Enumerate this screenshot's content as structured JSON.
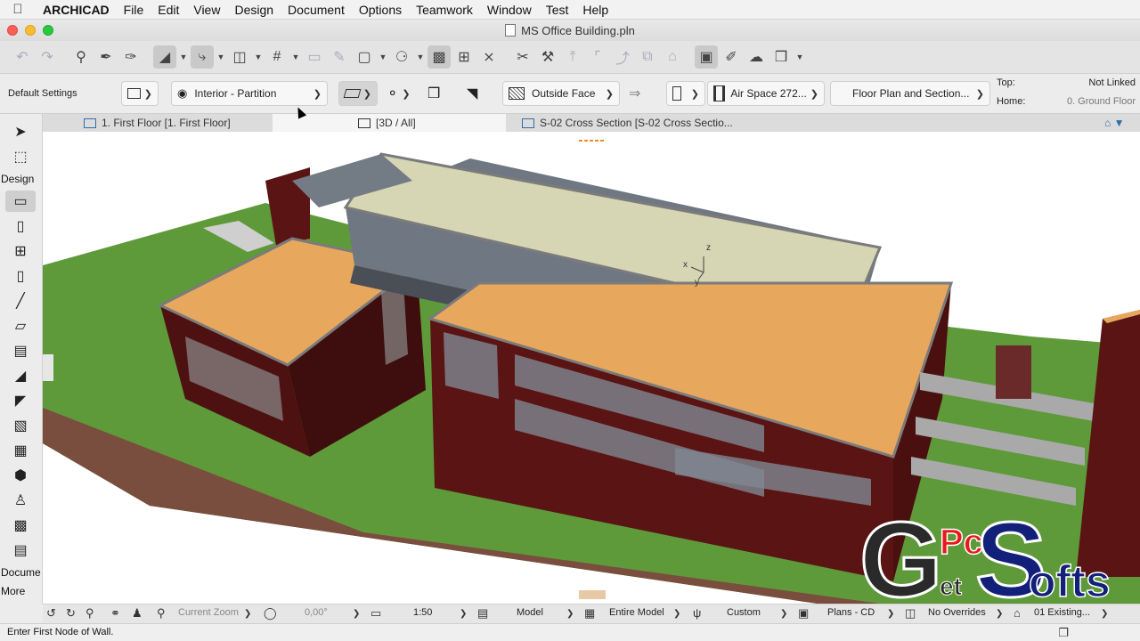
{
  "menubar": {
    "apple": "",
    "app": "ARCHICAD",
    "items": [
      "File",
      "Edit",
      "View",
      "Design",
      "Document",
      "Options",
      "Teamwork",
      "Window",
      "Test",
      "Help"
    ]
  },
  "window": {
    "title": "MS Office Building.pln"
  },
  "infobox": {
    "default_settings": "Default Settings",
    "structure": "Interior - Partition",
    "reference_line": "Outside Face",
    "composite": "Air Space 272...",
    "floor_plan": "Floor Plan and Section...",
    "top_label": "Top:",
    "top_value": "Not Linked",
    "home_label": "Home:",
    "home_value": "0. Ground Floor"
  },
  "tabs": [
    {
      "label": "1. First Floor [1. First Floor]"
    },
    {
      "label": "[3D / All]"
    },
    {
      "label": "S-02 Cross Section [S-02 Cross Sectio..."
    }
  ],
  "toolbox": {
    "design_label": "Design",
    "document_label": "Docume",
    "more_label": "More"
  },
  "viewport": {
    "axis_x": "x",
    "axis_y": "y",
    "axis_z": "z"
  },
  "statusbar": {
    "zoom": "Current Zoom",
    "angle": "0,00°",
    "scale": "1:50",
    "layer": "Model",
    "view": "Entire Model",
    "pen": "Custom",
    "model_view": "Plans - CD",
    "overrides": "No Overrides",
    "renovation": "01 Existing..."
  },
  "prompt": {
    "text": "Enter First Node of Wall."
  },
  "watermark": {
    "text": "GetPcSofts"
  },
  "colors": {
    "roof": "#e7a85e",
    "brick": "#5a1414",
    "grass": "#5f9a3a",
    "soil": "#8a6050",
    "accent": "#2f6ea8"
  }
}
